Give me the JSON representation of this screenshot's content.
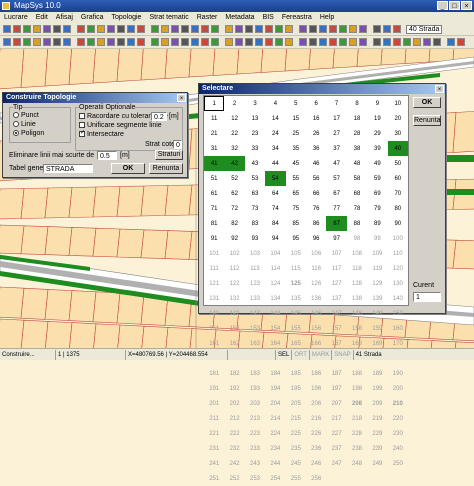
{
  "window": {
    "title": "MapSys 10.0",
    "controls": [
      "_",
      "□",
      "×"
    ]
  },
  "menu": [
    "Lucrare",
    "Edit",
    "Afisaj",
    "Grafica",
    "Topologie",
    "Strat tematic",
    "Raster",
    "Metadata",
    "BIS",
    "Fereastra",
    "Help"
  ],
  "toolbar1": {
    "right_label": "40 Strada"
  },
  "status": {
    "left": "Construire...",
    "pos": "1 | 1375",
    "coords": "X=480769.56 | Y=204468.554",
    "flags": [
      "SEL",
      "ORT",
      "MARK",
      "SNAP"
    ],
    "layer": "41 Strada"
  },
  "topo_dialog": {
    "title": "Construire Topologie",
    "tip_label": "Tip",
    "tip_options": [
      {
        "label": "Punct",
        "selected": false
      },
      {
        "label": "Linie",
        "selected": false
      },
      {
        "label": "Poligon",
        "selected": true
      }
    ],
    "op_label": "Operatii Optionale",
    "ops": [
      {
        "label": "Racordare cu toleranta de",
        "checked": false,
        "value": "0.2",
        "unit": "[m]"
      },
      {
        "label": "Unificare segmente linie",
        "checked": false
      },
      {
        "label": "Intersectare",
        "checked": true
      }
    ],
    "strat_cote_label": "Strat cote",
    "strat_cote_value": "0",
    "elim_label": "Eliminare linii mai scurte de",
    "elim_value": "0.5",
    "elim_unit": "[m]",
    "straturi_button": "Straturi",
    "tabel_label": "Tabel generat",
    "tabel_value": "STRADA",
    "ok_button": "OK",
    "cancel_button": "Renunta"
  },
  "select_dialog": {
    "title": "Selectare",
    "ok_button": "OK",
    "cancel_button": "Renunta",
    "curent_label": "Curent",
    "curent_value": "1",
    "green_cells": [
      40,
      41,
      42,
      54,
      87
    ],
    "gray_from": 98,
    "bold_cells": [
      125,
      172,
      173,
      175,
      208,
      210
    ],
    "selected_cell": 1,
    "cells": [
      "1",
      "2",
      "3",
      "4",
      "5",
      "6",
      "7",
      "8",
      "9",
      "10",
      "11",
      "12",
      "13",
      "14",
      "15",
      "16",
      "17",
      "18",
      "19",
      "20",
      "21",
      "22",
      "23",
      "24",
      "25",
      "26",
      "27",
      "28",
      "29",
      "30",
      "31",
      "32",
      "33",
      "34",
      "35",
      "36",
      "37",
      "38",
      "39",
      "40",
      "41",
      "42",
      "43",
      "44",
      "45",
      "46",
      "47",
      "48",
      "49",
      "50",
      "51",
      "52",
      "53",
      "54",
      "55",
      "56",
      "57",
      "58",
      "59",
      "60",
      "61",
      "62",
      "63",
      "64",
      "65",
      "66",
      "67",
      "68",
      "69",
      "70",
      "71",
      "72",
      "73",
      "74",
      "75",
      "76",
      "77",
      "78",
      "79",
      "80",
      "81",
      "82",
      "83",
      "84",
      "85",
      "86",
      "87",
      "88",
      "89",
      "90",
      "91",
      "92",
      "93",
      "94",
      "95",
      "96",
      "97",
      "98",
      "99",
      "100",
      "101",
      "102",
      "103",
      "104",
      "105",
      "106",
      "107",
      "108",
      "109",
      "110",
      "111",
      "112",
      "113",
      "114",
      "115",
      "116",
      "117",
      "118",
      "119",
      "120",
      "121",
      "122",
      "123",
      "124",
      "125",
      "126",
      "127",
      "128",
      "129",
      "130",
      "131",
      "132",
      "133",
      "134",
      "135",
      "136",
      "137",
      "138",
      "139",
      "140",
      "141",
      "142",
      "143",
      "144",
      "145",
      "146",
      "147",
      "148",
      "149",
      "150",
      "151",
      "152",
      "153",
      "154",
      "155",
      "156",
      "157",
      "158",
      "159",
      "160",
      "161",
      "162",
      "163",
      "164",
      "165",
      "166",
      "167",
      "168",
      "169",
      "170",
      "171",
      "172",
      "173",
      "174",
      "175",
      "176",
      "177",
      "178",
      "179",
      "180",
      "181",
      "182",
      "183",
      "184",
      "185",
      "186",
      "187",
      "188",
      "189",
      "190",
      "191",
      "192",
      "193",
      "194",
      "195",
      "196",
      "197",
      "198",
      "199",
      "200",
      "201",
      "202",
      "203",
      "204",
      "205",
      "206",
      "207",
      "208",
      "209",
      "210",
      "211",
      "212",
      "213",
      "214",
      "215",
      "216",
      "217",
      "218",
      "219",
      "220",
      "221",
      "222",
      "223",
      "224",
      "225",
      "226",
      "227",
      "228",
      "229",
      "230",
      "231",
      "232",
      "233",
      "234",
      "235",
      "236",
      "237",
      "238",
      "239",
      "240",
      "241",
      "242",
      "243",
      "244",
      "245",
      "246",
      "247",
      "248",
      "249",
      "250",
      "251",
      "252",
      "253",
      "254",
      "255",
      "256"
    ]
  },
  "colors": {
    "road_green": "#1e8c1e",
    "road_gray": "#b0b0b0",
    "parcel_fill": "#fbe0ae",
    "parcel_line": "#c24a3c",
    "map_bg": "#fbf2d8"
  }
}
